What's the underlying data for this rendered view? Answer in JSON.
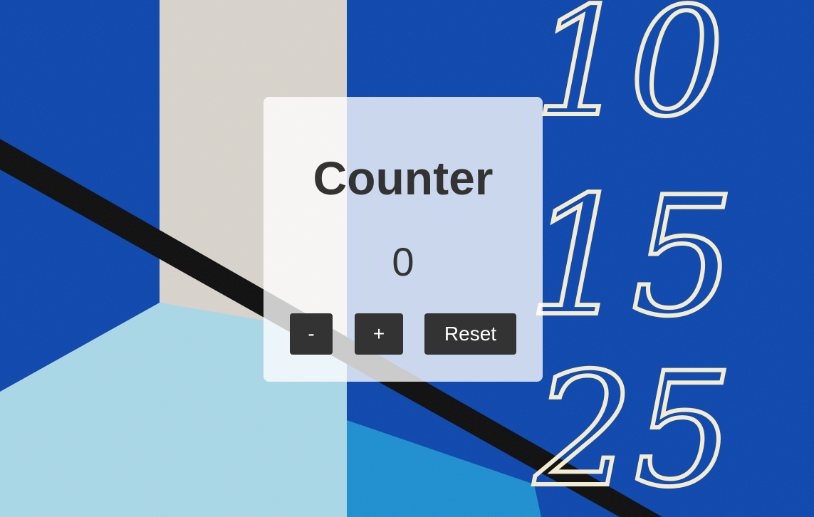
{
  "colors": {
    "deep_blue": "#0a45ad",
    "light_blue": "#a9d8e8",
    "bright_blue": "#1b8ed1",
    "concrete": "#d9d4cc",
    "stripe": "#0b0b0b",
    "chalk": "#f3ecd0",
    "button_bg": "#333333",
    "text": "#333333"
  },
  "counter": {
    "title": "Counter",
    "value": "0"
  },
  "buttons": {
    "decrement": "-",
    "increment": "+",
    "reset": "Reset"
  },
  "wall_numbers": {
    "top": "10",
    "middle": "15",
    "bottom": "25"
  }
}
